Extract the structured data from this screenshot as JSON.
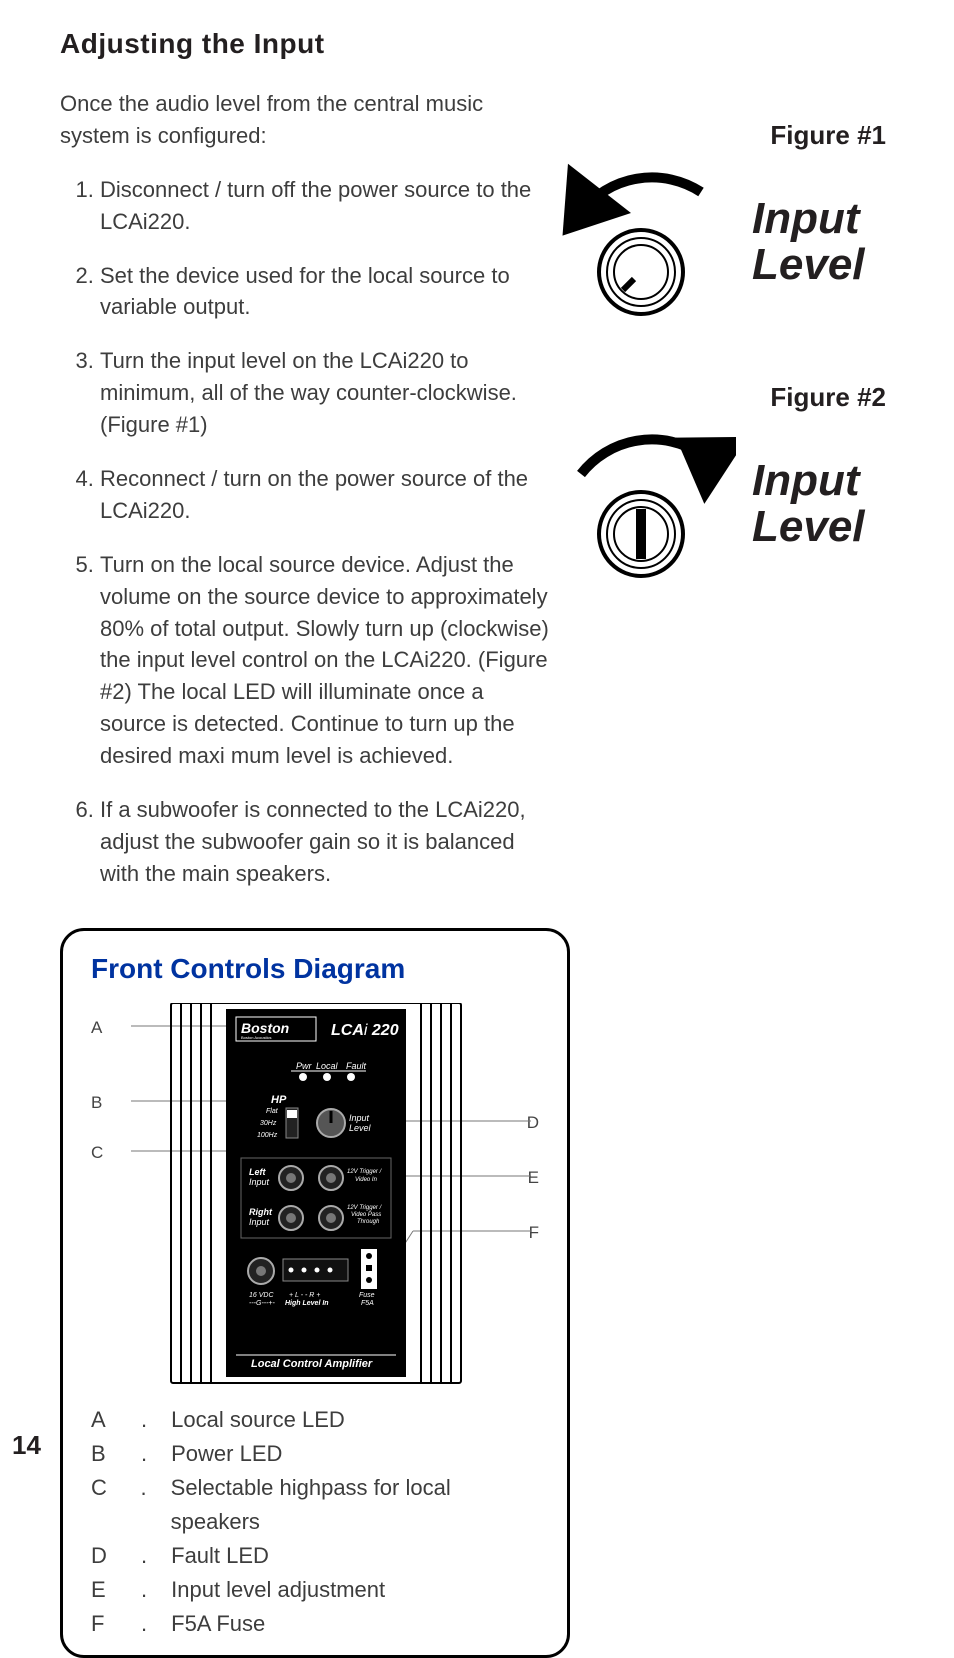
{
  "page": {
    "number": "14"
  },
  "heading": "Adjusting the Input",
  "intro": "Once the audio level from the central music system is configured:",
  "steps": [
    "Disconnect / turn off the power source to the LCAi220.",
    "Set the device used for the local source to variable output.",
    "Turn the input level on the LCAi220 to minimum, all of the way counter-clockwise. (Figure #1)",
    "Reconnect / turn on the power source of the LCAi220.",
    "Turn on the local source device. Adjust the volume on the source device to approximately 80% of total output. Slowly turn up (clockwise) the input level control on the LCAi220. (Figure #2) The local LED will illuminate once a source is detected. Continue to turn up the desired maxi mum level is achieved.",
    "If a subwoofer is connected to the LCAi220, adjust the subwoofer gain so it is balanced with the main speakers."
  ],
  "figures": {
    "fig1": {
      "caption": "Figure #1",
      "label_line1": "Input",
      "label_line2": "Level"
    },
    "fig2": {
      "caption": "Figure #2",
      "label_line1": "Input",
      "label_line2": "Level"
    }
  },
  "diagram": {
    "title": "Front Controls Diagram",
    "brand": "Boston",
    "brand_sub": "Boston Acoustics",
    "model_prefix": "LCA",
    "model_i": "i",
    "model_num": "220",
    "panel": {
      "pwr": "Pwr",
      "local": "Local",
      "fault": "Fault",
      "hp": "HP",
      "flat": "Flat",
      "30hz": "30Hz",
      "100hz": "100Hz",
      "input": "Input",
      "level": "Level",
      "left": "Left",
      "right": "Right",
      "inlab": "Input",
      "trig1a": "12V Trigger /",
      "trig1b": "Video In",
      "trig2a": "12V Trigger /",
      "trig2b": "Video Pass",
      "trig2c": "Through",
      "vdc1": "16 VDC",
      "vdc2": "---G---+-",
      "hl1": "+ L -    - R +",
      "hl2": "High Level In",
      "fuse1": "Fuse",
      "fuse2": "F5A",
      "bottom": "Local Control Amplifier"
    },
    "callouts": {
      "A": "A",
      "B": "B",
      "C": "C",
      "D": "D",
      "E": "E",
      "F": "F"
    },
    "key": {
      "A": "Local source LED",
      "B": "Power LED",
      "C": "Selectable highpass for local speakers",
      "D": "Fault LED",
      "E": "Input level adjustment",
      "F": "F5A Fuse"
    }
  }
}
